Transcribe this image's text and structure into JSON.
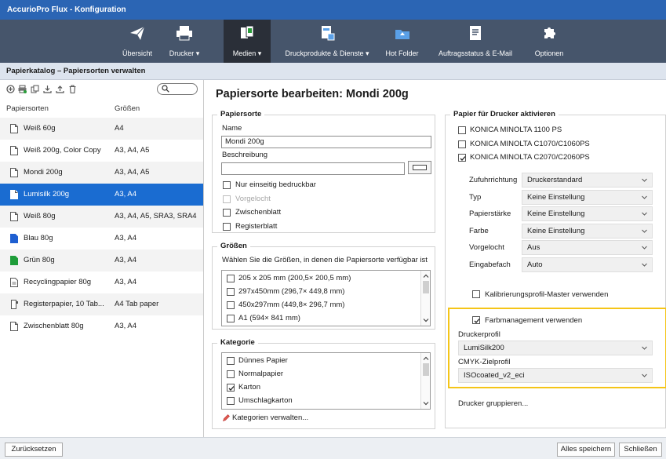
{
  "window": {
    "title": "AccurioPro Flux - Konfiguration"
  },
  "toolbar": [
    {
      "label": "Übersicht",
      "icon": "paper-plane-icon"
    },
    {
      "label": "Drucker ▾",
      "icon": "printer-icon"
    },
    {
      "label": "Medien ▾",
      "icon": "media-icon",
      "active": true
    },
    {
      "label": "Druckprodukte & Dienste ▾",
      "icon": "print-products-icon"
    },
    {
      "label": "Hot Folder",
      "icon": "hot-folder-icon"
    },
    {
      "label": "Auftragsstatus & E-Mail",
      "icon": "job-status-icon"
    },
    {
      "label": "Optionen",
      "icon": "puzzle-icon"
    }
  ],
  "breadcrumb": "Papierkatalog – Papiersorten verwalten",
  "catalog": {
    "col_types": "Papiersorten",
    "col_sizes": "Größen",
    "rows": [
      {
        "name": "Weiß 60g",
        "sizes": "A4",
        "icon": "paper-icon"
      },
      {
        "name": "Weiß 200g, Color Copy",
        "sizes": "A3, A4, A5",
        "icon": "paper-icon"
      },
      {
        "name": "Mondi 200g",
        "sizes": "A3, A4, A5",
        "icon": "paper-icon"
      },
      {
        "name": "Lumisilk 200g",
        "sizes": "A3, A4",
        "icon": "paper-icon",
        "selected": true
      },
      {
        "name": "Weiß 80g",
        "sizes": "A3, A4, A5, SRA3, SRA4",
        "icon": "paper-icon"
      },
      {
        "name": "Blau 80g",
        "sizes": "A3, A4",
        "icon": "blue-paper-icon"
      },
      {
        "name": "Grün 80g",
        "sizes": "A3, A4",
        "icon": "green-paper-icon"
      },
      {
        "name": "Recyclingpapier 80g",
        "sizes": "A3, A4",
        "icon": "recycled-paper-icon"
      },
      {
        "name": "Registerpapier, 10 Tab...",
        "sizes": "A4 Tab paper",
        "icon": "tab-paper-icon"
      },
      {
        "name": "Zwischenblatt 80g",
        "sizes": "A3, A4",
        "icon": "paper-icon"
      }
    ]
  },
  "editor": {
    "heading": "Papiersorte bearbeiten: Mondi 200g",
    "papiersorte": {
      "title": "Papiersorte",
      "name_label": "Name",
      "name_value": "Mondi 200g",
      "desc_label": "Beschreibung",
      "desc_value": "",
      "options": [
        {
          "label": "Nur einseitig bedruckbar",
          "checked": false,
          "disabled": false
        },
        {
          "label": "Vorgelocht",
          "checked": false,
          "disabled": true
        },
        {
          "label": "Zwischenblatt",
          "checked": false,
          "disabled": false
        },
        {
          "label": "Registerblatt",
          "checked": false,
          "disabled": false
        }
      ]
    },
    "groessen": {
      "title": "Größen",
      "hint": "Wählen Sie die Größen, in denen die Papiersorte verfügbar ist",
      "items": [
        {
          "label": "205 x 205 mm (200,5× 200,5 mm)",
          "checked": false
        },
        {
          "label": "297x450mm (296,7× 449,8 mm)",
          "checked": false
        },
        {
          "label": "450x297mm (449,8× 296,7 mm)",
          "checked": false
        },
        {
          "label": "A1 (594× 841 mm)",
          "checked": false
        }
      ]
    },
    "kategorie": {
      "title": "Kategorie",
      "items": [
        {
          "label": "Dünnes Papier",
          "checked": false
        },
        {
          "label": "Normalpapier",
          "checked": false
        },
        {
          "label": "Karton",
          "checked": true
        },
        {
          "label": "Umschlagkarton",
          "checked": false
        }
      ],
      "manage_link": "Kategorien verwalten..."
    }
  },
  "printers": {
    "title": "Papier für Drucker aktivieren",
    "list": [
      {
        "label": "KONICA MINOLTA 1100 PS",
        "checked": false
      },
      {
        "label": "KONICA MINOLTA C1070/C1060PS",
        "checked": false
      },
      {
        "label": "KONICA MINOLTA C2070/C2060PS",
        "checked": true
      }
    ],
    "settings": [
      {
        "label": "Zufuhrrichtung",
        "value": "Druckerstandard"
      },
      {
        "label": "Typ",
        "value": "Keine Einstellung"
      },
      {
        "label": "Papierstärke",
        "value": "Keine Einstellung"
      },
      {
        "label": "Farbe",
        "value": "Keine Einstellung"
      },
      {
        "label": "Vorgelocht",
        "value": "Aus"
      },
      {
        "label": "Eingabefach",
        "value": "Auto"
      }
    ],
    "calibration_label": "Kalibrierungsprofil-Master verwenden",
    "color_mgmt": {
      "label": "Farbmanagement verwenden",
      "checked": true,
      "printer_profile_label": "Druckerprofil",
      "printer_profile_value": "LumiSilk200",
      "cmyk_label": "CMYK-Zielprofil",
      "cmyk_value": "ISOcoated_v2_eci"
    },
    "group_link": "Drucker gruppieren..."
  },
  "buttons": {
    "reset": "Zurücksetzen",
    "save_all": "Alles speichern",
    "close": "Schließen"
  },
  "colors": {
    "titlebar": "#2b65b4",
    "toolbar": "#46556b",
    "selection": "#1a6cd1",
    "highlight": "#f5c518"
  }
}
